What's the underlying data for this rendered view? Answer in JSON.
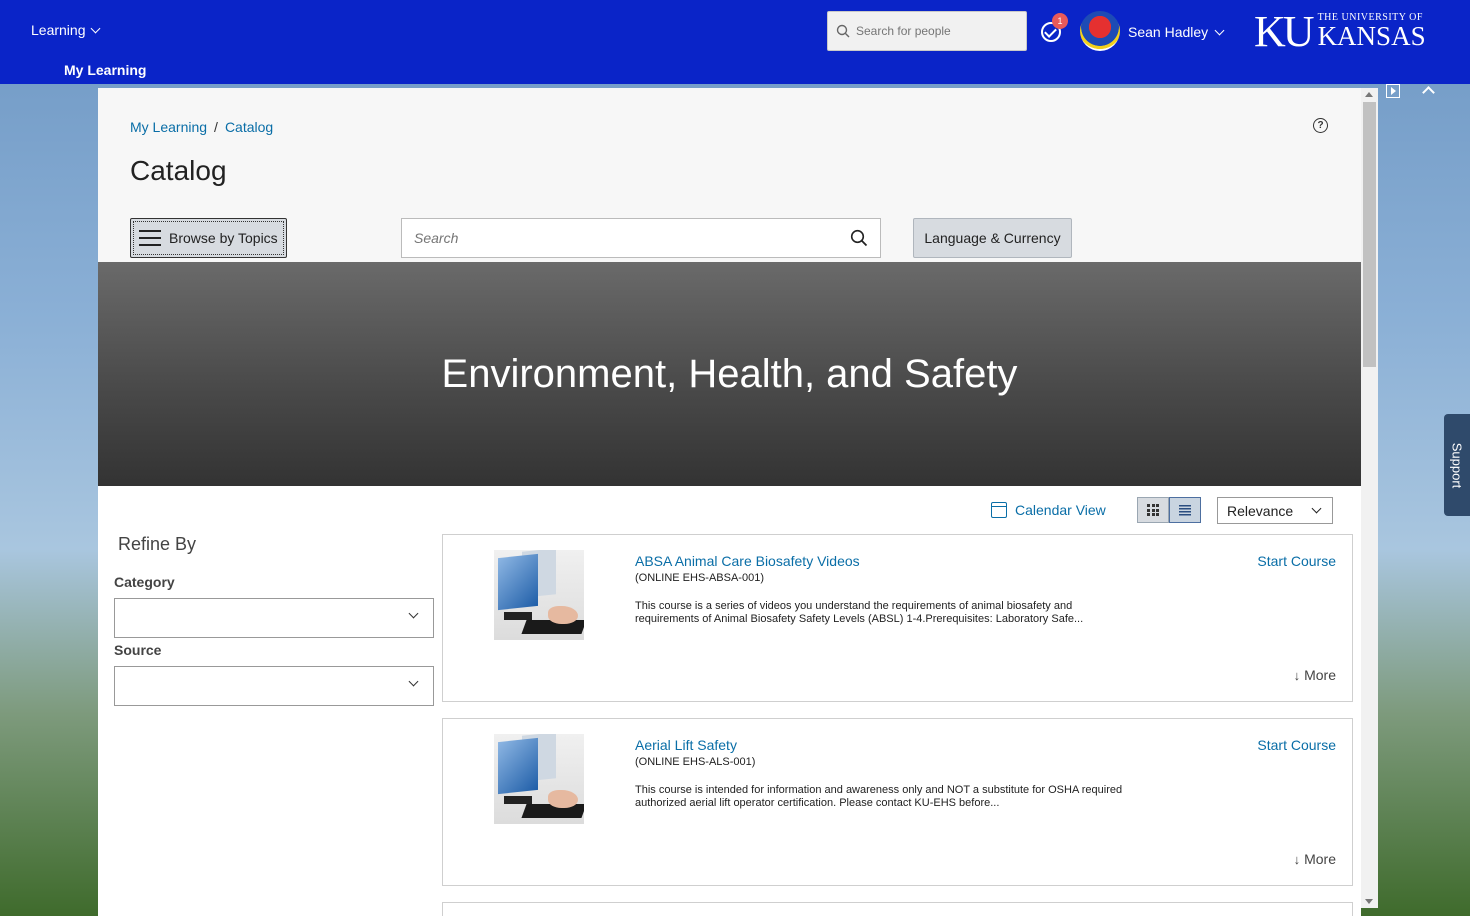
{
  "header": {
    "learning_menu": "Learning",
    "sub_nav": "My Learning",
    "people_search_placeholder": "Search for people",
    "notification_count": "1",
    "user_name": "Sean Hadley",
    "logo_ku": "KU",
    "logo_small": "THE UNIVERSITY OF",
    "logo_big": "KANSAS"
  },
  "breadcrumb": {
    "items": [
      "My Learning",
      "Catalog"
    ],
    "separator": "/"
  },
  "page": {
    "title": "Catalog",
    "browse_button": "Browse by Topics",
    "search_placeholder": "Search",
    "language_button": "Language & Currency",
    "help_icon": "?"
  },
  "hero": {
    "title": "Environment, Health, and Safety"
  },
  "toolbar": {
    "calendar_view": "Calendar View",
    "sort_value": "Relevance"
  },
  "refine": {
    "title": "Refine By",
    "category_label": "Category",
    "source_label": "Source"
  },
  "courses": [
    {
      "title": "ABSA Animal Care Biosafety Videos",
      "code": "(ONLINE EHS-ABSA-001)",
      "description": "This course is a series of videos you understand the requirements of animal biosafety and requirements of Animal Biosafety Safety Levels (ABSL) 1-4.Prerequisites: Laboratory Safe...",
      "action": "Start Course",
      "more": "More"
    },
    {
      "title": "Aerial Lift Safety",
      "code": "(ONLINE EHS-ALS-001)",
      "description": "This course is intended for information and awareness only and NOT a substitute for OSHA required authorized aerial lift operator certification. Please contact KU-EHS before...",
      "action": "Start Course",
      "more": "More"
    }
  ],
  "support_tab": "Support",
  "colors": {
    "header_bg": "#0a24c8",
    "link": "#0a6ea7",
    "badge": "#e85a5a",
    "support_tab": "#2f4a6b"
  }
}
